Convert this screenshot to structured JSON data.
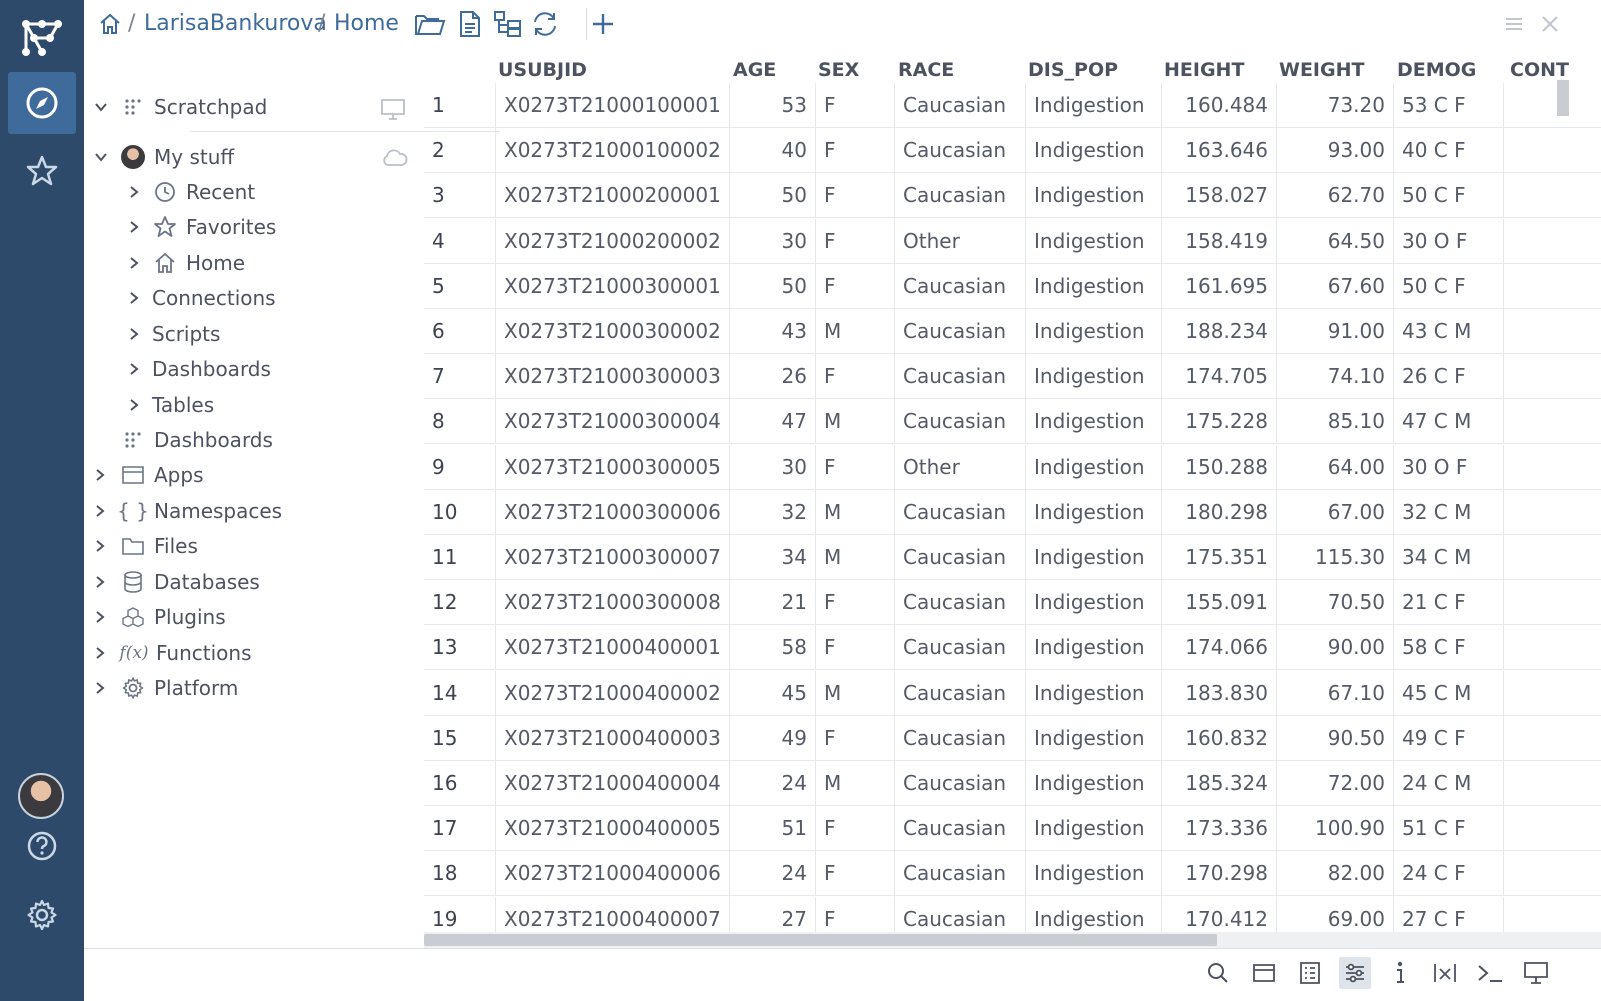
{
  "breadcrumb": {
    "user": "LarisaBankurova",
    "separator": "/",
    "current": "Home"
  },
  "tree": {
    "scratchpad": "Scratchpad",
    "my_stuff": "My stuff",
    "my_stuff_children": [
      "Recent",
      "Favorites",
      "Home",
      "Connections",
      "Scripts",
      "Dashboards",
      "Tables"
    ],
    "root_items": [
      "Dashboards",
      "Apps",
      "Namespaces",
      "Files",
      "Databases",
      "Plugins",
      "Functions",
      "Platform"
    ]
  },
  "grid": {
    "columns": [
      "USUBJID",
      "AGE",
      "SEX",
      "RACE",
      "DIS_POP",
      "HEIGHT",
      "WEIGHT",
      "DEMOG",
      "CONT"
    ],
    "rows": [
      [
        "1",
        "X0273T21000100001",
        "53",
        "F",
        "Caucasian",
        "Indigestion",
        "160.484",
        "73.20",
        "53 C F"
      ],
      [
        "2",
        "X0273T21000100002",
        "40",
        "F",
        "Caucasian",
        "Indigestion",
        "163.646",
        "93.00",
        "40 C F"
      ],
      [
        "3",
        "X0273T21000200001",
        "50",
        "F",
        "Caucasian",
        "Indigestion",
        "158.027",
        "62.70",
        "50 C F"
      ],
      [
        "4",
        "X0273T21000200002",
        "30",
        "F",
        "Other",
        "Indigestion",
        "158.419",
        "64.50",
        "30 O F"
      ],
      [
        "5",
        "X0273T21000300001",
        "50",
        "F",
        "Caucasian",
        "Indigestion",
        "161.695",
        "67.60",
        "50 C F"
      ],
      [
        "6",
        "X0273T21000300002",
        "43",
        "M",
        "Caucasian",
        "Indigestion",
        "188.234",
        "91.00",
        "43 C M"
      ],
      [
        "7",
        "X0273T21000300003",
        "26",
        "F",
        "Caucasian",
        "Indigestion",
        "174.705",
        "74.10",
        "26 C F"
      ],
      [
        "8",
        "X0273T21000300004",
        "47",
        "M",
        "Caucasian",
        "Indigestion",
        "175.228",
        "85.10",
        "47 C M"
      ],
      [
        "9",
        "X0273T21000300005",
        "30",
        "F",
        "Other",
        "Indigestion",
        "150.288",
        "64.00",
        "30 O F"
      ],
      [
        "10",
        "X0273T21000300006",
        "32",
        "M",
        "Caucasian",
        "Indigestion",
        "180.298",
        "67.00",
        "32 C M"
      ],
      [
        "11",
        "X0273T21000300007",
        "34",
        "M",
        "Caucasian",
        "Indigestion",
        "175.351",
        "115.30",
        "34 C M"
      ],
      [
        "12",
        "X0273T21000300008",
        "21",
        "F",
        "Caucasian",
        "Indigestion",
        "155.091",
        "70.50",
        "21 C F"
      ],
      [
        "13",
        "X0273T21000400001",
        "58",
        "F",
        "Caucasian",
        "Indigestion",
        "174.066",
        "90.00",
        "58 C F"
      ],
      [
        "14",
        "X0273T21000400002",
        "45",
        "M",
        "Caucasian",
        "Indigestion",
        "183.830",
        "67.10",
        "45 C M"
      ],
      [
        "15",
        "X0273T21000400003",
        "49",
        "F",
        "Caucasian",
        "Indigestion",
        "160.832",
        "90.50",
        "49 C F"
      ],
      [
        "16",
        "X0273T21000400004",
        "24",
        "M",
        "Caucasian",
        "Indigestion",
        "185.324",
        "72.00",
        "24 C M"
      ],
      [
        "17",
        "X0273T21000400005",
        "51",
        "F",
        "Caucasian",
        "Indigestion",
        "173.336",
        "100.90",
        "51 C F"
      ],
      [
        "18",
        "X0273T21000400006",
        "24",
        "F",
        "Caucasian",
        "Indigestion",
        "170.298",
        "82.00",
        "24 C F"
      ],
      [
        "19",
        "X0273T21000400007",
        "27",
        "F",
        "Caucasian",
        "Indigestion",
        "170.412",
        "69.00",
        "27 C F"
      ]
    ]
  },
  "colors": {
    "rail": "#2e4a6a",
    "rail_active": "#3f6b9a",
    "link": "#3f6b9a"
  }
}
